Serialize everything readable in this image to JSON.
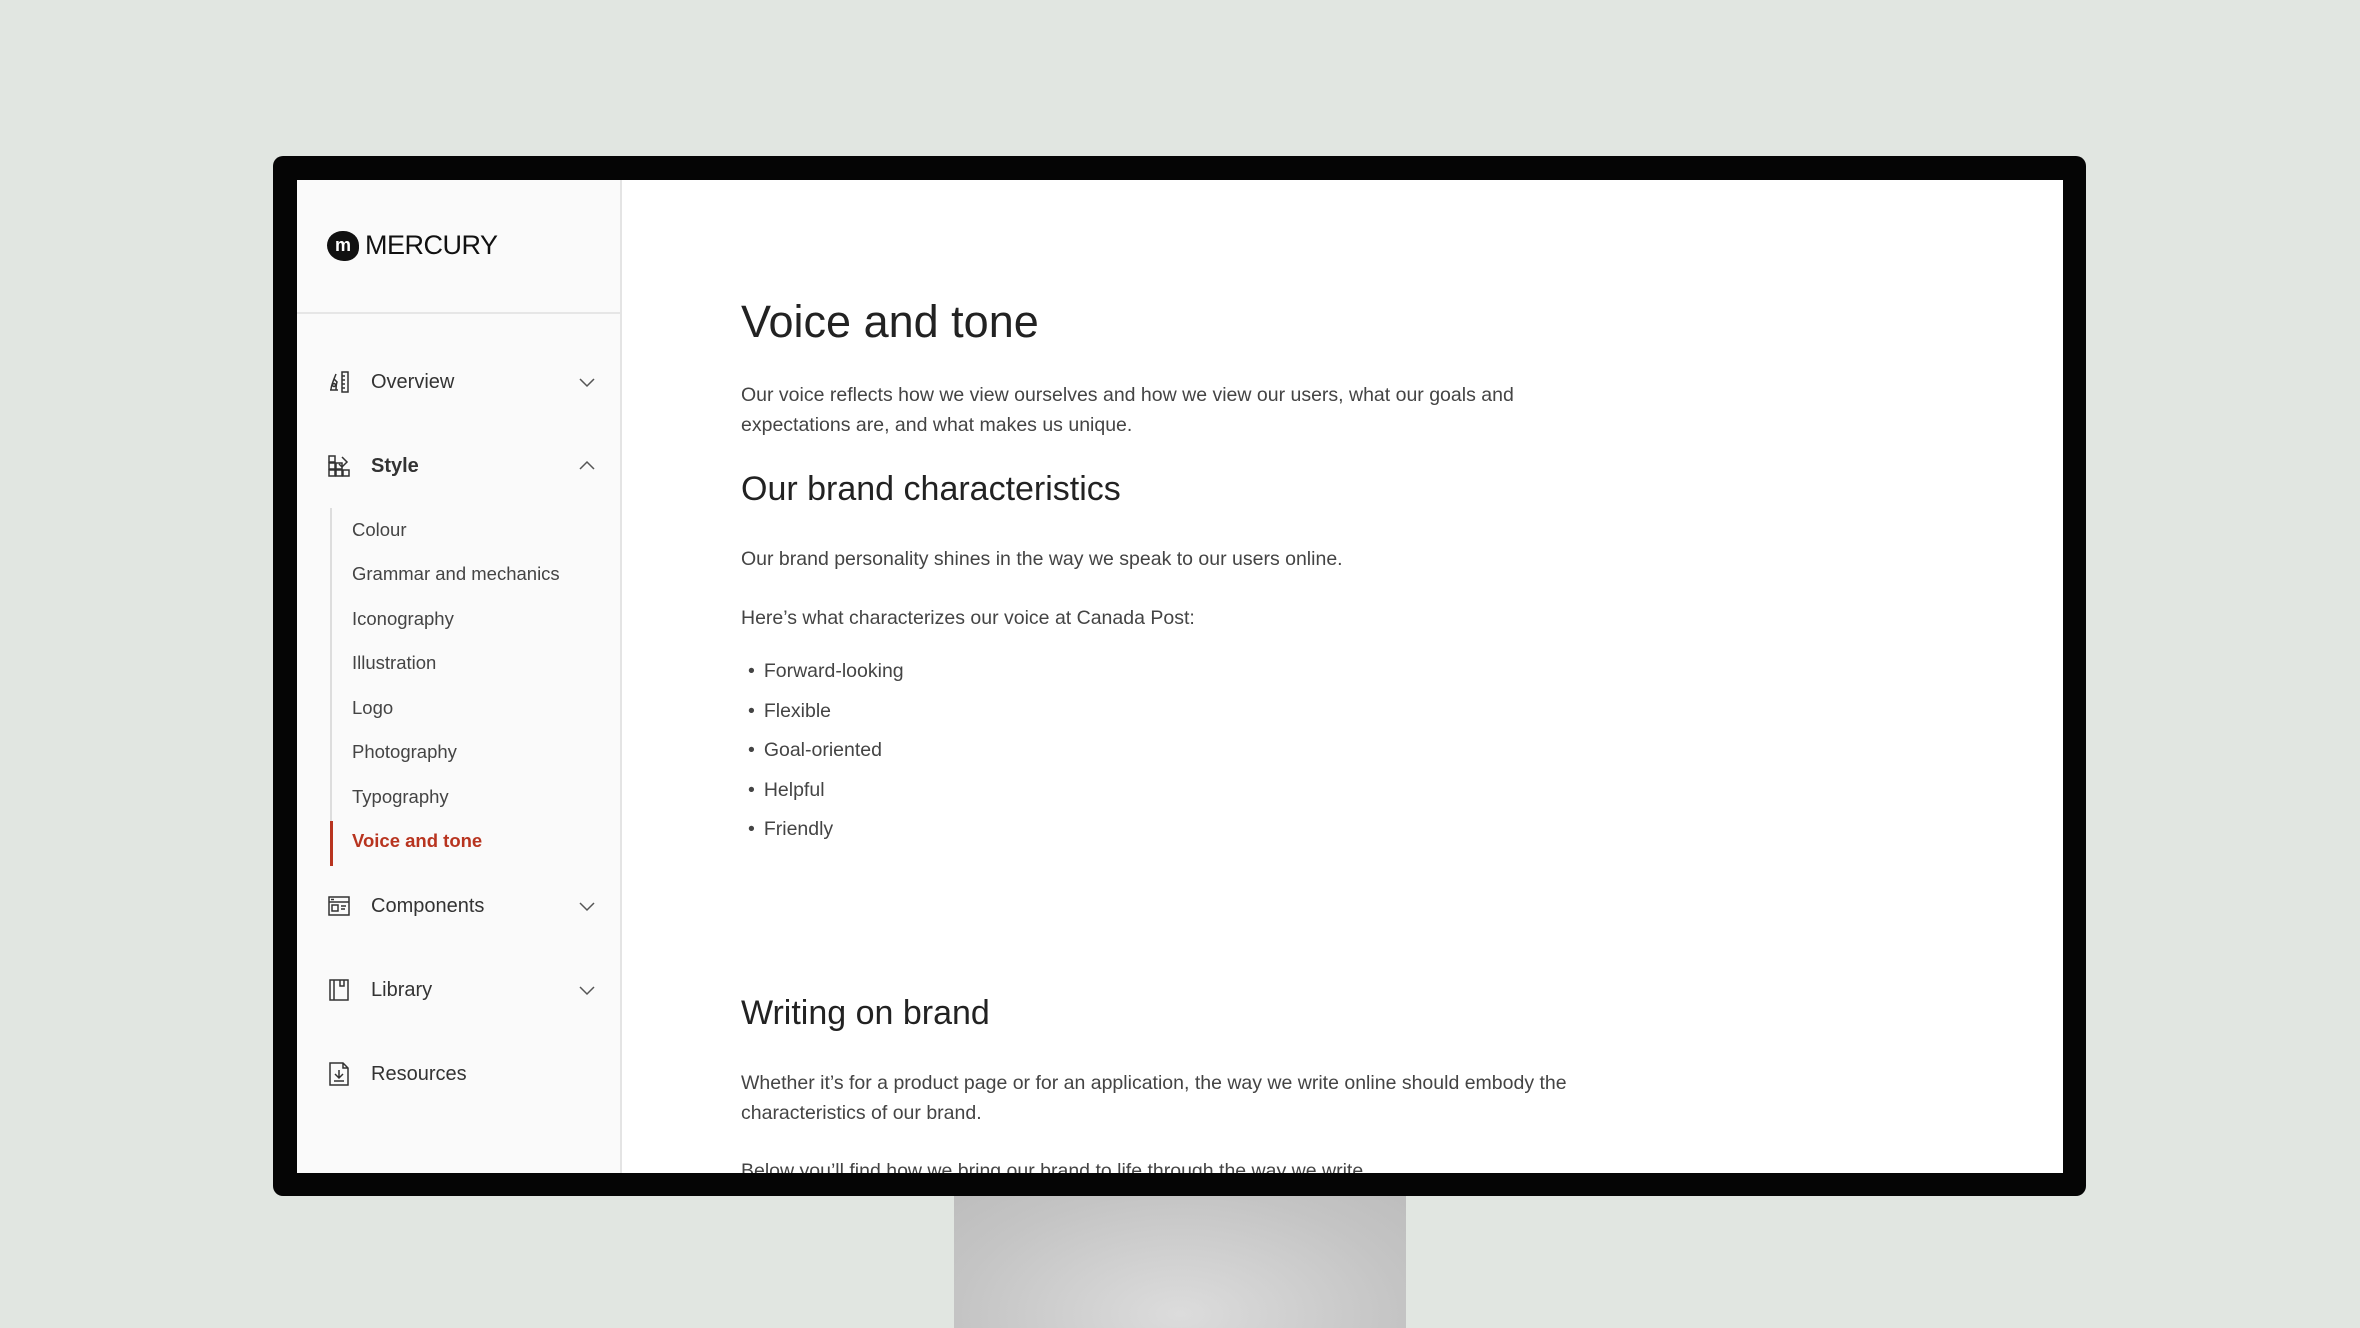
{
  "brand": {
    "name": "MERCURY",
    "logo_mark": "m"
  },
  "sidebar": {
    "items": [
      {
        "label": "Overview",
        "icon": "pen-ruler-icon",
        "state": "collapsed"
      },
      {
        "label": "Style",
        "icon": "style-grid-icon",
        "state": "expanded"
      },
      {
        "label": "Components",
        "icon": "components-window-icon",
        "state": "collapsed"
      },
      {
        "label": "Library",
        "icon": "book-icon",
        "state": "collapsed"
      },
      {
        "label": "Resources",
        "icon": "download-file-icon"
      }
    ],
    "style_subitems": [
      "Colour",
      "Grammar and mechanics",
      "Iconography",
      "Illustration",
      "Logo",
      "Photography",
      "Typography",
      "Voice and tone"
    ],
    "active": "Voice and tone"
  },
  "content": {
    "title": "Voice and tone",
    "intro_1": "Our voice reflects how we view ourselves and how we view our users, what our goals and",
    "intro_2": "expectations are, and what makes us unique.",
    "h_characteristics": "Our brand characteristics",
    "p_personality": "Our brand personality shines in the way we speak to our users online.",
    "p_heres": "Here’s what characterizes our voice at Canada Post:",
    "bullets": [
      "Forward-looking",
      "Flexible",
      "Goal-oriented",
      "Helpful",
      "Friendly"
    ],
    "h_writing": "Writing on brand",
    "writing_1": "Whether it’s for a product page or for an application, the way we write online should embody the",
    "writing_2": "characteristics of our brand.",
    "writing_3": "Below you’ll find how we bring our brand to life through the way we write."
  },
  "colors": {
    "accent": "#b8341f",
    "background": "#e1e6e1",
    "sidebar": "#fafafa"
  }
}
